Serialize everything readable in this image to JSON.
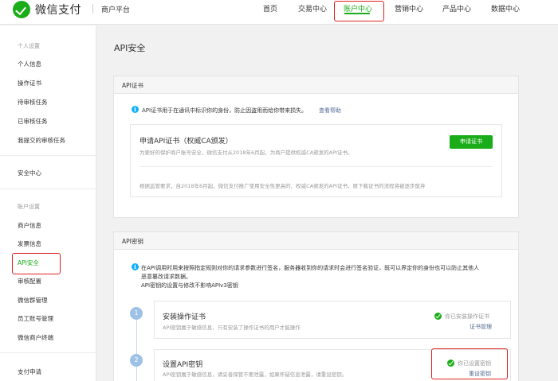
{
  "header": {
    "brand": "微信支付",
    "platform": "商户平台",
    "nav": [
      "首页",
      "交易中心",
      "账户中心",
      "营销中心",
      "产品中心",
      "数据中心"
    ],
    "active_nav": "账户中心"
  },
  "sidebar": {
    "groups": [
      {
        "title": "个人设置",
        "items": [
          "个人信息",
          "操作证书",
          "待审核任务",
          "已审核任务",
          "我提交的审核任务"
        ]
      },
      {
        "title": "",
        "items": [
          "安全中心"
        ]
      },
      {
        "title": "账户设置",
        "items": [
          "商户信息",
          "发票信息",
          "API安全",
          "审核配置",
          "微信群管理",
          "员工账号管理",
          "微信商户终端"
        ]
      },
      {
        "title": "",
        "items": [
          "支付申请"
        ]
      }
    ],
    "active_item": "API安全"
  },
  "main": {
    "title": "API安全",
    "cert_panel": {
      "header": "API证书",
      "info": "API证书用于在通讯中标识你的身份，防止因盗用而给你带来损失。",
      "help_link": "查看帮助",
      "card": {
        "title": "申请API证书（权威CA颁发）",
        "desc": "为更好的保护商户账号安全，微信支付从2018年6月起，为商户提供权威CA颁发的API证书。",
        "button": "申请证书",
        "note": "根据监管要求，自2018年6月起，微信支付推广使用安全性更高的、权威CA颁发的API证书，原下载证书的流程将被逐步废弃"
      }
    },
    "key_panel": {
      "header": "API密钥",
      "info_line1": "在API调用时用来按照指定规则对你的请求参数进行签名，服务器收到你的请求时会进行签名验证，既可以界定你的身份也可以防止其他人",
      "info_line2": "恶意篡改请求数据。",
      "info_line3": "API密钥的设置与修改不影响APIv3密钥",
      "steps": [
        {
          "num": "1",
          "title": "安装操作证书",
          "desc": "API密钥属于敏感信息，只有安装了操作证书的用户才能操作",
          "status": "你已安装操作证书",
          "action": "证书管理"
        },
        {
          "num": "2",
          "title": "设置API密钥",
          "desc": "API密钥属于敏感信息，请妥善保管不要泄露，如果怀疑信息泄露，请重设密钥。",
          "status": "你已设置密钥",
          "action": "重设密钥"
        }
      ]
    }
  },
  "colors": {
    "brand_green": "#1aad19",
    "link_blue": "#576b95",
    "highlight_red": "#e02020",
    "info_blue": "#10aeff"
  }
}
